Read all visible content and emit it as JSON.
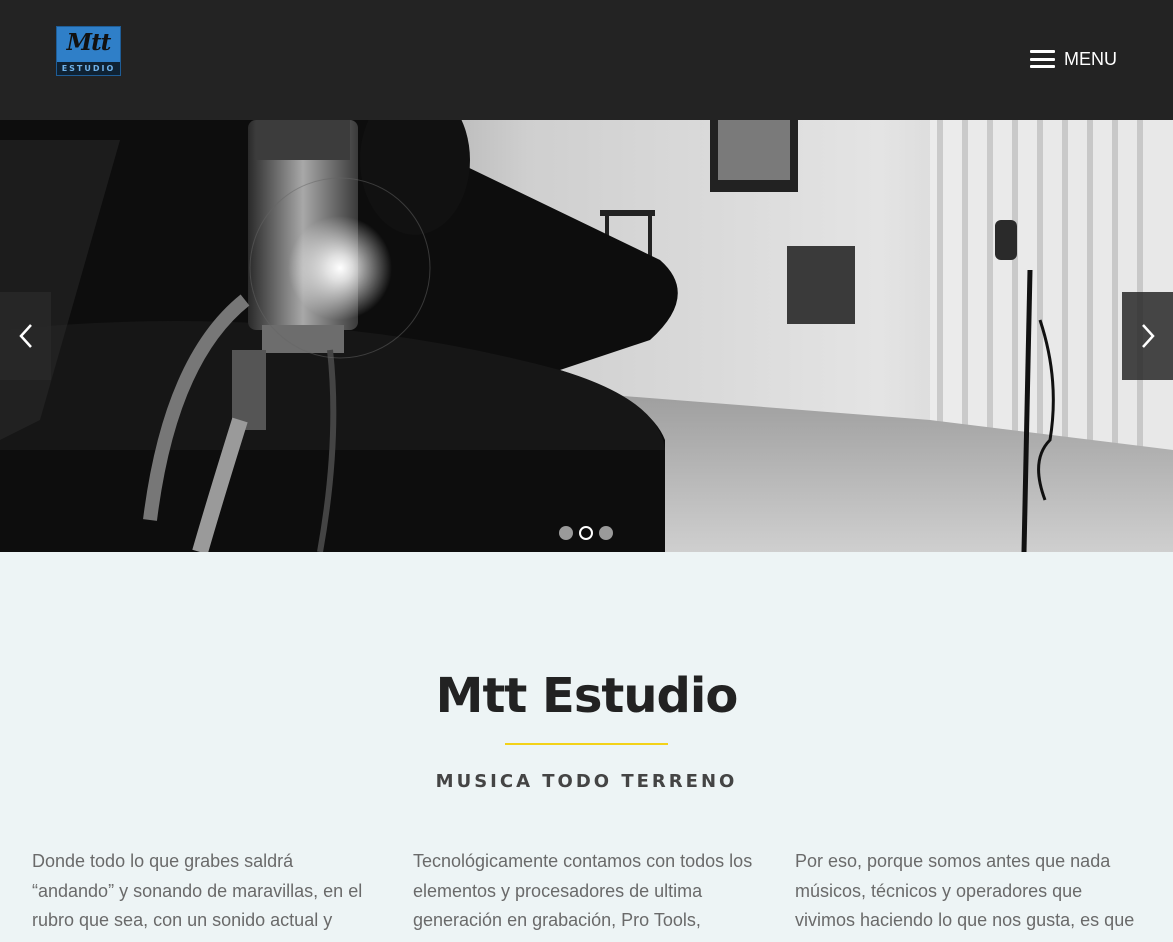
{
  "header": {
    "logo_main": "Mtt",
    "logo_sub": "ESTUDIO",
    "menu_label": "MENU",
    "icons": [
      "hamburger-menu-icon"
    ]
  },
  "slider": {
    "prev_icon": "chevron-left-icon",
    "next_icon": "chevron-right-icon",
    "slide_count": 3,
    "active_slide": 2,
    "image": "black-and-white recording studio with microphone and piano"
  },
  "intro": {
    "title": "Mtt Estudio",
    "subtitle": "MUSICA TODO TERRENO",
    "accent_color": "#f3d218"
  },
  "columns": [
    {
      "text": "Donde todo lo que grabes saldrá “andando” y sonando de maravillas, en el rubro que sea, con un sonido actual y"
    },
    {
      "text": "Tecnológicamente contamos con todos los elementos y procesadores de ultima generación en grabación, Pro Tools,"
    },
    {
      "text": "Por eso, porque somos antes que nada músicos, técnicos y operadores que vivimos haciendo lo que nos gusta, es que"
    }
  ]
}
